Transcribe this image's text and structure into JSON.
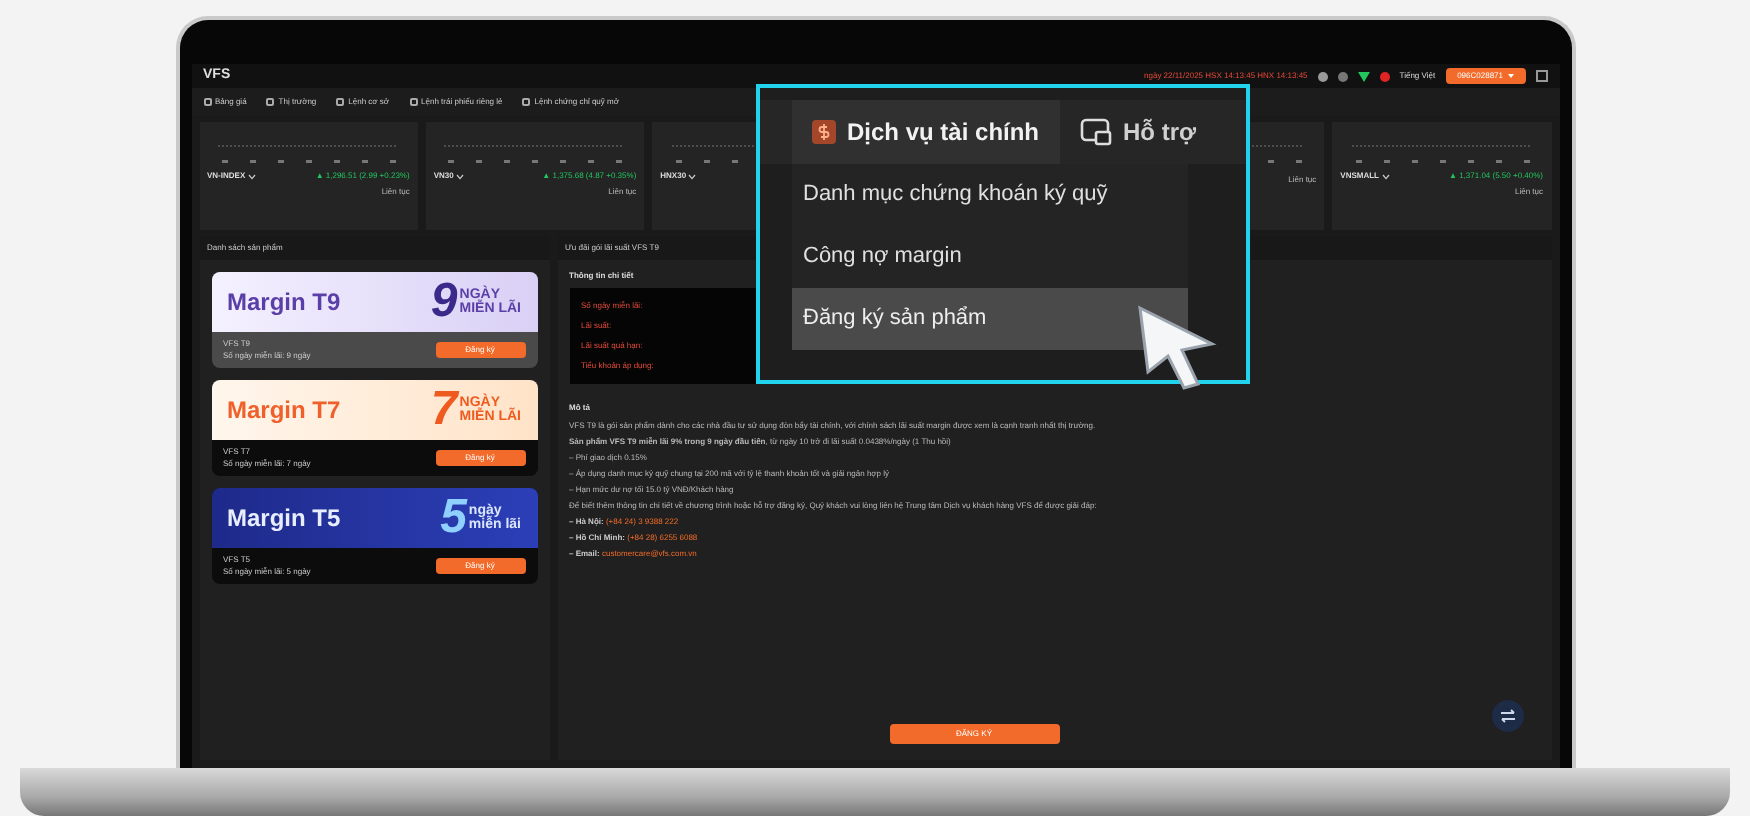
{
  "top_bar": {
    "logo": "VFS",
    "session": "ngày 22/11/2025 HSX 14:13:45 HNX 14:13:45",
    "language": "Tiếng Việt",
    "account": "096C028871"
  },
  "nav": [
    {
      "label": "Bảng giá"
    },
    {
      "label": "Thị trường"
    },
    {
      "label": "Lệnh cơ sở"
    },
    {
      "label": "Lệnh trái phiếu riêng lẻ"
    },
    {
      "label": "Lệnh chứng chỉ quỹ mở"
    }
  ],
  "indices": [
    {
      "name": "VN-INDEX",
      "change": "▲ 1,296.51 (2.99 +0.23%)",
      "status": "Liên tục"
    },
    {
      "name": "VN30",
      "change": "▲ 1,375.68 (4.87 +0.35%)",
      "status": "Liên tục"
    },
    {
      "name": "HNX30"
    },
    {
      "status": "Liên tục"
    },
    {
      "name": "VNSMALL",
      "change": "▲ 1,371.04 (5.50 +0.40%)",
      "status": "Liên tục"
    }
  ],
  "product_list": {
    "title": "Danh sách sản phẩm",
    "products": [
      {
        "kind": "purple",
        "banner_title": "Margin T9",
        "days": "9",
        "tag_top": "NGÀY",
        "tag_bottom": "MIỄN LÃI",
        "name": "VFS T9",
        "detail": "Số ngày miễn lãi: 9 ngày",
        "button": "Đăng ký",
        "selected": true
      },
      {
        "kind": "orange",
        "banner_title": "Margin T7",
        "days": "7",
        "tag_top": "NGÀY",
        "tag_bottom": "MIỄN LÃI",
        "name": "VFS T7",
        "detail": "Số ngày miễn lãi: 7 ngày",
        "button": "Đăng ký",
        "selected": false
      },
      {
        "kind": "blue",
        "banner_title": "Margin T5",
        "days": "5",
        "tag_top": "ngày",
        "tag_bottom": "miễn lãi",
        "name": "VFS T5",
        "detail": "Số ngày miễn lãi: 5 ngày",
        "button": "Đăng ký",
        "selected": false
      }
    ]
  },
  "detail": {
    "title": "Ưu đãi gói lãi suất VFS T9",
    "info_title": "Thông tin chi tiết",
    "fields": [
      "Số ngày miễn lãi:",
      "Lãi suất:",
      "Lãi suất quá hạn:",
      "Tiểu khoản áp dụng:"
    ],
    "description_title": "Mô tả",
    "description": [
      "VFS T9 là gói sản phẩm dành cho các nhà đầu tư sử dụng đòn bẩy tài chính, với chính sách lãi suất margin được xem là cạnh tranh nhất thị trường.",
      "**Sản phẩm VFS T9 miễn lãi 9% trong 9 ngày đầu tiên**, từ ngày 10 trở đi lãi suất 0.0438%/ngày (1 Thu hồi)",
      "– Phí giao dịch 0.15%",
      "– Áp dụng danh mục ký quỹ chung tại 200 mã với tỷ lệ thanh khoản tốt và giải ngân hợp lý",
      "– Hạn mức dư nợ tối 15.0 tỷ VNĐ/Khách hàng",
      "Để biết thêm thông tin chi tiết về chương trình hoặc hỗ trợ đăng ký, Quý khách vui lòng liên hệ Trung tâm Dịch vụ khách hàng VFS để được giải đáp:"
    ],
    "contacts": [
      {
        "label": "– Hà Nội:",
        "value": "(+84 24) 3 9388 222"
      },
      {
        "label": "– Hồ Chí Minh:",
        "value": "(+84 28) 6255 6088"
      },
      {
        "label": "– Email:",
        "value": "customercare@vfs.com.vn"
      }
    ],
    "register_button": "ĐĂNG KÝ"
  },
  "menu": {
    "tabs": [
      {
        "label": "Dịch vụ tài chính",
        "selected": true
      },
      {
        "label": "Hỗ trợ",
        "selected": false
      }
    ],
    "items": [
      {
        "label": "Danh mục chứng khoán ký quỹ",
        "selected": false
      },
      {
        "label": "Công nợ margin",
        "selected": false
      },
      {
        "label": "Đăng ký sản phẩm",
        "selected": true
      }
    ]
  }
}
